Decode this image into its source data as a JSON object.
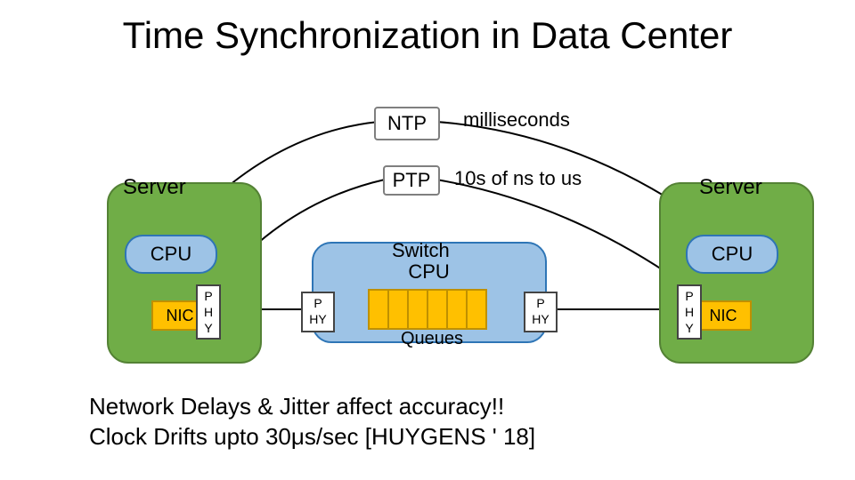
{
  "title": "Time Synchronization in Data Center",
  "server_label": "Server",
  "cpu_label": "CPU",
  "nic_label": "NIC",
  "phy_lines": {
    "a": "P",
    "b": "H",
    "c": "Y"
  },
  "sphy_lines": {
    "a": "P",
    "b": "HY"
  },
  "switch": {
    "label_top": "Switch",
    "label_cpu": "CPU",
    "queues": "Queues"
  },
  "protocols": {
    "ntp": {
      "name": "NTP",
      "desc": "milliseconds"
    },
    "ptp": {
      "name": "PTP",
      "desc": "10s of ns to us"
    }
  },
  "footer": {
    "line1": "Network Delays & Jitter affect accuracy!!",
    "line2": "Clock Drifts upto 30μs/sec [HUYGENS ' 18]"
  }
}
